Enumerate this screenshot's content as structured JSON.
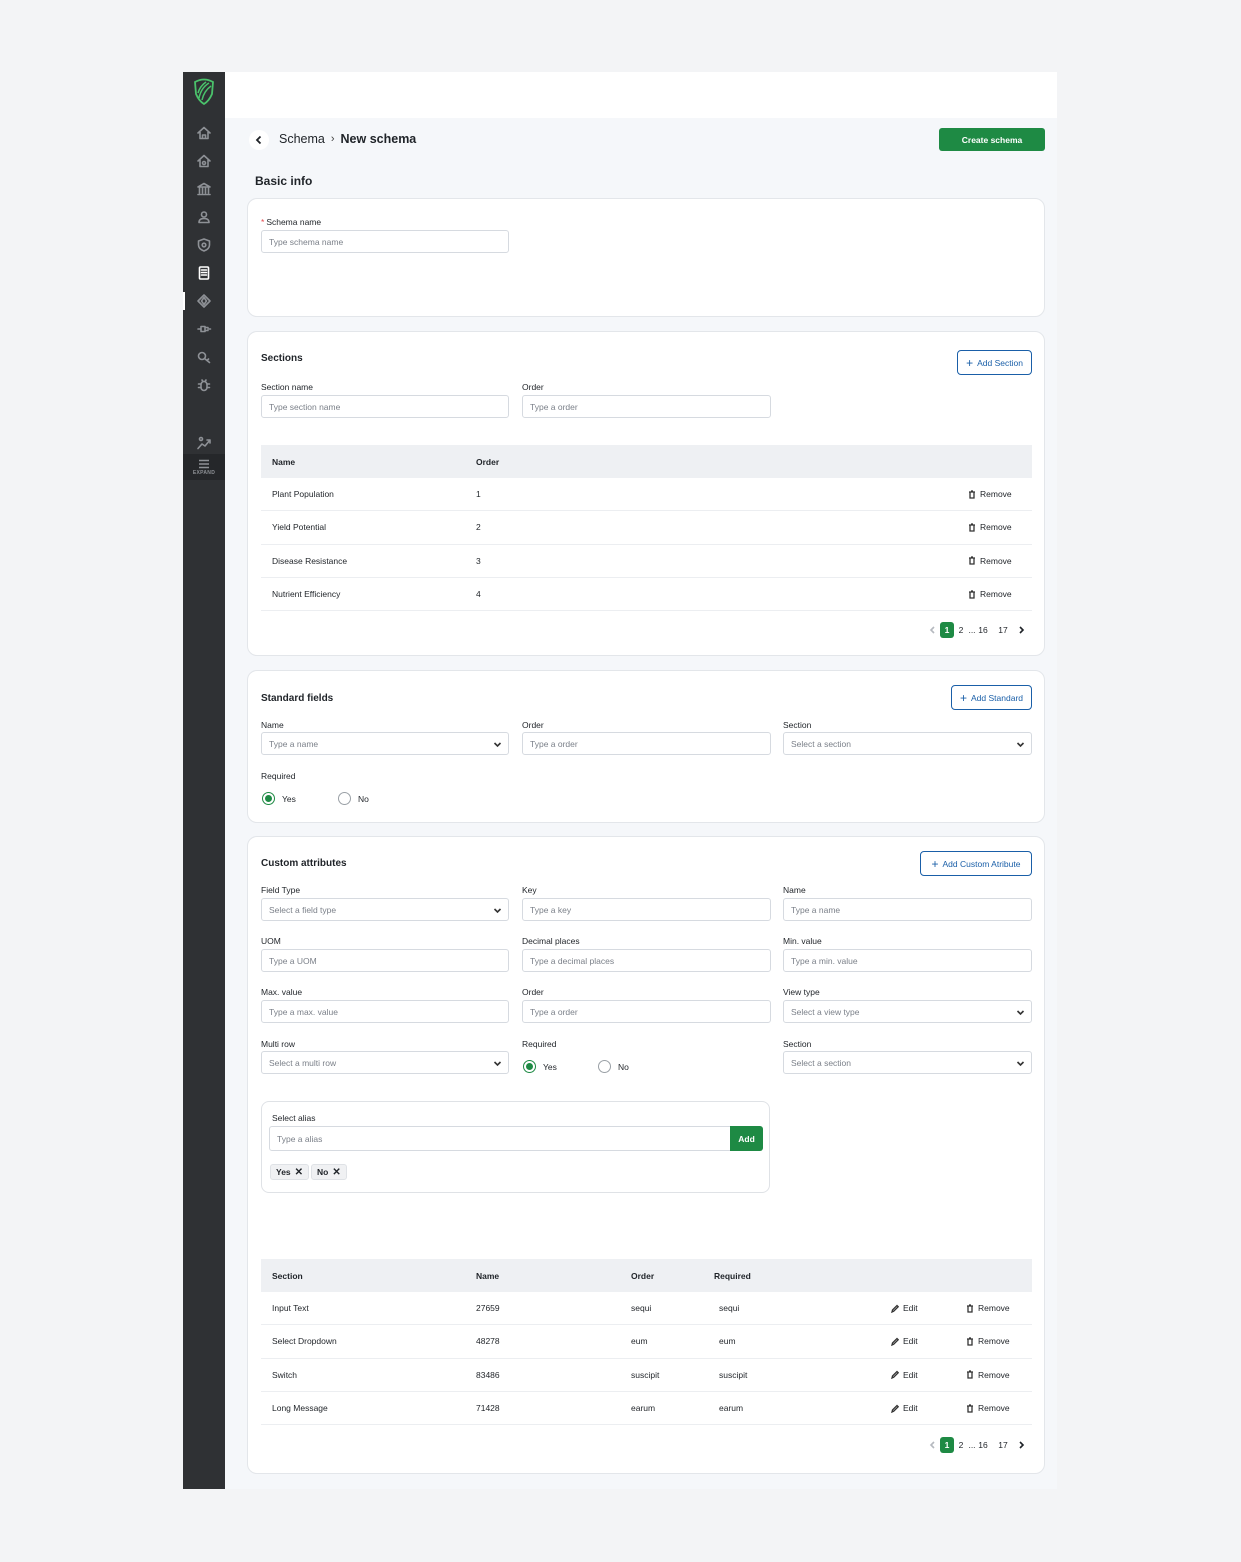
{
  "app": {
    "brand_color": "#1e8a44",
    "link_color": "#1a5fa8"
  },
  "sidebar": {
    "icons": [
      "home-icon",
      "home-alt-icon",
      "bank-icon",
      "user-icon",
      "shield-icon",
      "document-icon",
      "schema-icon",
      "plug-icon",
      "key-search-icon",
      "bug-icon",
      "growth-icon"
    ],
    "expand_label": "EXPAND"
  },
  "header": {
    "breadcrumb_parent": "Schema",
    "breadcrumb_separator": "›",
    "breadcrumb_current": "New schema",
    "create_button": "Create schema"
  },
  "basic_info": {
    "title": "Basic info",
    "schema_name_label": "Schema name",
    "schema_name_placeholder": "Type schema name"
  },
  "sections": {
    "title": "Sections",
    "add_button": "Add Section",
    "section_name_label": "Section name",
    "section_name_placeholder": "Type section name",
    "order_label": "Order",
    "order_placeholder": "Type a order",
    "table": {
      "columns": [
        "Name",
        "Order"
      ],
      "rows": [
        {
          "name": "Plant Population",
          "order": "1",
          "action": "Remove"
        },
        {
          "name": "Yield Potential",
          "order": "2",
          "action": "Remove"
        },
        {
          "name": "Disease Resistance",
          "order": "3",
          "action": "Remove"
        },
        {
          "name": "Nutrient Efficiency",
          "order": "4",
          "action": "Remove"
        }
      ]
    },
    "pagination": {
      "current": "1",
      "next": "2",
      "ellipsis": "...",
      "p16": "16",
      "p17": "17"
    }
  },
  "standard_fields": {
    "title": "Standard fields",
    "add_button": "Add Standard",
    "name_label": "Name",
    "name_placeholder": "Type a name",
    "order_label": "Order",
    "order_placeholder": "Type a order",
    "section_label": "Section",
    "section_placeholder": "Select a section",
    "required_label": "Required",
    "yes": "Yes",
    "no": "No",
    "required_selected": "Yes"
  },
  "custom_attributes": {
    "title": "Custom attributes",
    "add_button": "Add Custom Atribute",
    "field_type_label": "Field Type",
    "field_type_placeholder": "Select a field type",
    "key_label": "Key",
    "key_placeholder": "Type a key",
    "name_label": "Name",
    "name_placeholder": "Type a name",
    "uom_label": "UOM",
    "uom_placeholder": "Type a UOM",
    "decimal_label": "Decimal places",
    "decimal_placeholder": "Type a decimal places",
    "min_label": "Min. value",
    "min_placeholder": "Type a min. value",
    "max_label": "Max. value",
    "max_placeholder": "Type a max. value",
    "order_label": "Order",
    "order_placeholder": "Type a order",
    "view_type_label": "View type",
    "view_type_placeholder": "Select a view type",
    "multi_row_label": "Multi row",
    "multi_row_placeholder": "Select a multi row",
    "required_label": "Required",
    "yes": "Yes",
    "no": "No",
    "section_label": "Section",
    "section_placeholder": "Select a section",
    "alias": {
      "label": "Select alias",
      "placeholder": "Type a alias",
      "add_button": "Add",
      "tags": [
        "Yes",
        "No"
      ]
    },
    "table": {
      "columns": [
        "Section",
        "Name",
        "Order",
        "Required"
      ],
      "rows": [
        {
          "section": "Input Text",
          "name": "27659",
          "order": "sequi",
          "required": "sequi",
          "edit": "Edit",
          "remove": "Remove"
        },
        {
          "section": "Select Dropdown",
          "name": "48278",
          "order": "eum",
          "required": "eum",
          "edit": "Edit",
          "remove": "Remove"
        },
        {
          "section": "Switch",
          "name": "83486",
          "order": "suscipit",
          "required": "suscipit",
          "edit": "Edit",
          "remove": "Remove"
        },
        {
          "section": "Long Message",
          "name": "71428",
          "order": "earum",
          "required": "earum",
          "edit": "Edit",
          "remove": "Remove"
        }
      ]
    },
    "pagination": {
      "current": "1",
      "next": "2",
      "ellipsis": "...",
      "p16": "16",
      "p17": "17"
    }
  }
}
